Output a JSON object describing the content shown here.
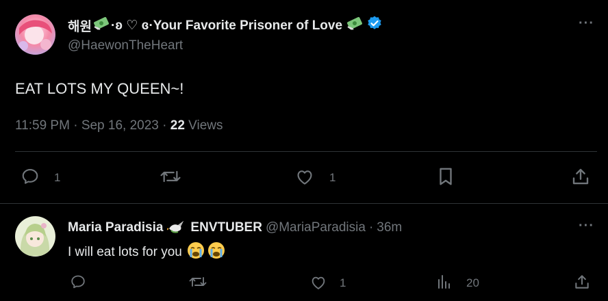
{
  "main_tweet": {
    "display_name_prefix": "해원",
    "display_name_mid": "·ʚ ♡ ɞ·Your Favorite Prisoner of Love",
    "handle": "@HaewonTheHeart",
    "text": "EAT LOTS MY QUEEN~!",
    "time": "11:59 PM",
    "date": "Sep 16, 2023",
    "views_count": "22",
    "views_label": "Views",
    "actions": {
      "reply_count": "1",
      "retweet_count": "",
      "like_count": "1"
    },
    "verified_color": "#1d9bf0"
  },
  "reply_tweet": {
    "display_name": "Maria Paradisia",
    "display_name_suffix": "ENVTUBER",
    "handle": "@MariaParadisia",
    "time_ago": "36m",
    "text": "I will eat lots for you",
    "actions": {
      "reply_count": "",
      "retweet_count": "",
      "like_count": "1",
      "views_count": "20"
    }
  },
  "colors": {
    "background": "#000000",
    "text": "#e7e9ea",
    "muted": "#71767b",
    "divider": "#2f3336"
  },
  "icons": [
    "more-icon",
    "money-emoji",
    "verified-badge-icon",
    "reply-icon",
    "retweet-icon",
    "like-icon",
    "bookmark-icon",
    "share-icon",
    "analytics-icon",
    "dove-emoji",
    "crying-emoji"
  ]
}
